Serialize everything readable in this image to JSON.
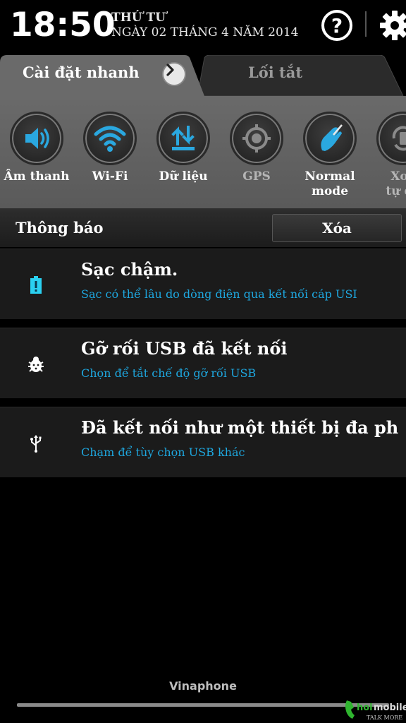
{
  "status": {
    "time": "18:50",
    "day": "THỨ TƯ",
    "date": "NGÀY 02 THÁNG 4 NĂM 2014",
    "help_icon": "help-circle-icon",
    "settings_icon": "gear-icon"
  },
  "tabs": [
    {
      "label": "Cài đặt nhanh",
      "active": true
    },
    {
      "label": "Lối tắt",
      "active": false
    }
  ],
  "quick_settings": [
    {
      "label": "Âm thanh",
      "icon": "volume-icon",
      "on": true
    },
    {
      "label": "Wi-Fi",
      "icon": "wifi-icon",
      "on": true
    },
    {
      "label": "Dữ liệu",
      "icon": "data-transfer-icon",
      "on": true
    },
    {
      "label": "GPS",
      "icon": "gps-icon",
      "on": false
    },
    {
      "label_line1": "Normal",
      "label_line2": "mode",
      "icon": "hand-stylus-icon",
      "on": true
    },
    {
      "label_line1": "Xoa",
      "label_line2": "tự đo",
      "icon": "auto-rotate-icon",
      "on": false
    }
  ],
  "notifications_header": {
    "title": "Thông báo",
    "clear_label": "Xóa"
  },
  "notifications": [
    {
      "icon": "battery-alert-icon",
      "title": "Sạc chậm.",
      "subtitle": "Sạc có thể lâu do dòng điện qua kết nối cáp USI"
    },
    {
      "icon": "bug-icon",
      "title": "Gỡ rối USB đã kết nối",
      "subtitle": "Chọn để tắt chế độ gỡ rối USB"
    },
    {
      "icon": "usb-icon",
      "title": "Đã kết nối như một thiết bị đa ph",
      "subtitle": "Chạm để tùy chọn USB khác"
    }
  ],
  "carrier": "Vinaphone",
  "watermark": {
    "text": "hoimobile",
    "tagline": "TALK MORE"
  },
  "colors": {
    "accent": "#2aa8e0",
    "subtitle": "#1ea7df",
    "panel": "#626262"
  }
}
